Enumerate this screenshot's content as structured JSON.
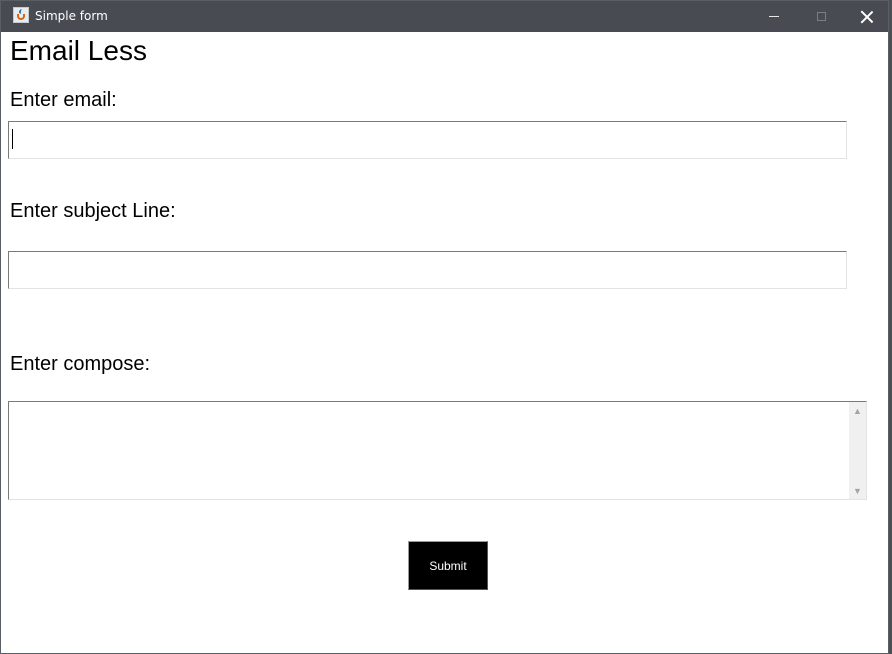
{
  "window": {
    "title": "Simple form",
    "controls": {
      "minimize": "minimize",
      "maximize": "maximize",
      "close": "close"
    }
  },
  "form": {
    "heading": "Email Less",
    "email_label": "Enter email:",
    "email_value": "",
    "subject_label": "Enter subject Line:",
    "subject_value": "",
    "compose_label": "Enter compose:",
    "compose_value": "",
    "submit_label": "Submit"
  },
  "colors": {
    "titlebar": "#484c52",
    "button_bg": "#000000",
    "button_text": "#ffffff"
  },
  "icons": {
    "app": "java-cup-icon",
    "scroll_up": "chevron-up-icon",
    "scroll_down": "chevron-down-icon"
  }
}
